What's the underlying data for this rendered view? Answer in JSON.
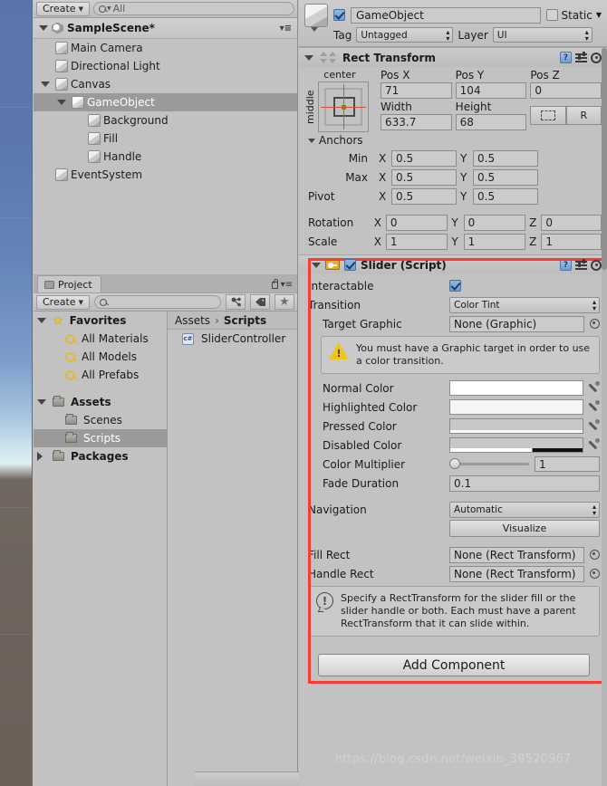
{
  "hierarchy": {
    "toolbar": {
      "create_label": "Create",
      "search_placeholder": "All",
      "search_value": "All"
    },
    "scene_name": "SampleScene*",
    "items": [
      {
        "label": "Main Camera",
        "depth": 1,
        "expandable": false,
        "selected": false
      },
      {
        "label": "Directional Light",
        "depth": 1,
        "expandable": false,
        "selected": false
      },
      {
        "label": "Canvas",
        "depth": 1,
        "expandable": true,
        "selected": false
      },
      {
        "label": "GameObject",
        "depth": 2,
        "expandable": true,
        "selected": true
      },
      {
        "label": "Background",
        "depth": 3,
        "expandable": false,
        "selected": false
      },
      {
        "label": "Fill",
        "depth": 3,
        "expandable": false,
        "selected": false
      },
      {
        "label": "Handle",
        "depth": 3,
        "expandable": false,
        "selected": false
      },
      {
        "label": "EventSystem",
        "depth": 1,
        "expandable": false,
        "selected": false
      }
    ]
  },
  "project": {
    "tab_label": "Project",
    "create_label": "Create",
    "search_value": "",
    "breadcrumb": [
      "Assets",
      "Scripts"
    ],
    "tree": [
      {
        "label": "Favorites",
        "kind": "favorites",
        "depth": 0,
        "expandable": true,
        "bold": true,
        "selected": false
      },
      {
        "label": "All Materials",
        "kind": "search",
        "depth": 1,
        "expandable": false,
        "bold": false,
        "selected": false
      },
      {
        "label": "All Models",
        "kind": "search",
        "depth": 1,
        "expandable": false,
        "bold": false,
        "selected": false
      },
      {
        "label": "All Prefabs",
        "kind": "search",
        "depth": 1,
        "expandable": false,
        "bold": false,
        "selected": false
      },
      {
        "label": "Assets",
        "kind": "folder",
        "depth": 0,
        "expandable": true,
        "bold": true,
        "selected": false
      },
      {
        "label": "Scenes",
        "kind": "folder",
        "depth": 1,
        "expandable": false,
        "bold": false,
        "selected": false
      },
      {
        "label": "Scripts",
        "kind": "folder",
        "depth": 1,
        "expandable": false,
        "bold": false,
        "selected": true
      },
      {
        "label": "Packages",
        "kind": "folder",
        "depth": 0,
        "expandable": true,
        "bold": true,
        "collapsed": true,
        "selected": false
      }
    ],
    "assets": [
      {
        "label": "SliderController",
        "kind": "csharp-script"
      }
    ]
  },
  "inspector": {
    "object_name": "GameObject",
    "enabled": true,
    "static_label": "Static",
    "static_checked": false,
    "tag_label": "Tag",
    "tag_value": "Untagged",
    "layer_label": "Layer",
    "layer_value": "UI",
    "rect_transform": {
      "title": "Rect Transform",
      "anchor_preset_h": "center",
      "anchor_preset_v": "middle",
      "pos_x_label": "Pos X",
      "pos_x": "71",
      "pos_y_label": "Pos Y",
      "pos_y": "104",
      "pos_z_label": "Pos Z",
      "pos_z": "0",
      "width_label": "Width",
      "width": "633.7",
      "height_label": "Height",
      "height": "68",
      "blueprint_button": "",
      "raw_button": "R",
      "anchors_label": "Anchors",
      "min_label": "Min",
      "min_x": "0.5",
      "min_y": "0.5",
      "max_label": "Max",
      "max_x": "0.5",
      "max_y": "0.5",
      "pivot_label": "Pivot",
      "pivot_x": "0.5",
      "pivot_y": "0.5",
      "rotation_label": "Rotation",
      "rot_x": "0",
      "rot_y": "0",
      "rot_z": "0",
      "scale_label": "Scale",
      "scale_x": "1",
      "scale_y": "1",
      "scale_z": "1",
      "axis_x": "X",
      "axis_y": "Y",
      "axis_z": "Z"
    },
    "slider_script": {
      "title": "Slider (Script)",
      "enabled": true,
      "interactable_label": "Interactable",
      "interactable": true,
      "transition_label": "Transition",
      "transition_value": "Color Tint",
      "target_graphic_label": "Target Graphic",
      "target_graphic_value": "None (Graphic)",
      "warning_text": "You must have a Graphic target in order to use a color transition.",
      "normal_color_label": "Normal Color",
      "highlighted_color_label": "Highlighted Color",
      "pressed_color_label": "Pressed Color",
      "disabled_color_label": "Disabled Color",
      "normal_color": "#ffffff",
      "highlighted_color": "#f5f5f5",
      "pressed_color": "#c8c8c8",
      "disabled_color": "#c8c8c8",
      "color_multiplier_label": "Color Multiplier",
      "color_multiplier": "1",
      "fade_duration_label": "Fade Duration",
      "fade_duration": "0.1",
      "navigation_label": "Navigation",
      "navigation_value": "Automatic",
      "visualize_label": "Visualize",
      "fill_rect_label": "Fill Rect",
      "fill_rect_value": "None (Rect Transform)",
      "handle_rect_label": "Handle Rect",
      "handle_rect_value": "None (Rect Transform)",
      "info_text": "Specify a RectTransform for the slider fill or the slider handle or both. Each must have a parent RectTransform that it can slide within."
    },
    "add_component_label": "Add Component",
    "highlight_color": "#fb3b30"
  },
  "watermark": "https://blog.csdn.net/weixin_39520967"
}
